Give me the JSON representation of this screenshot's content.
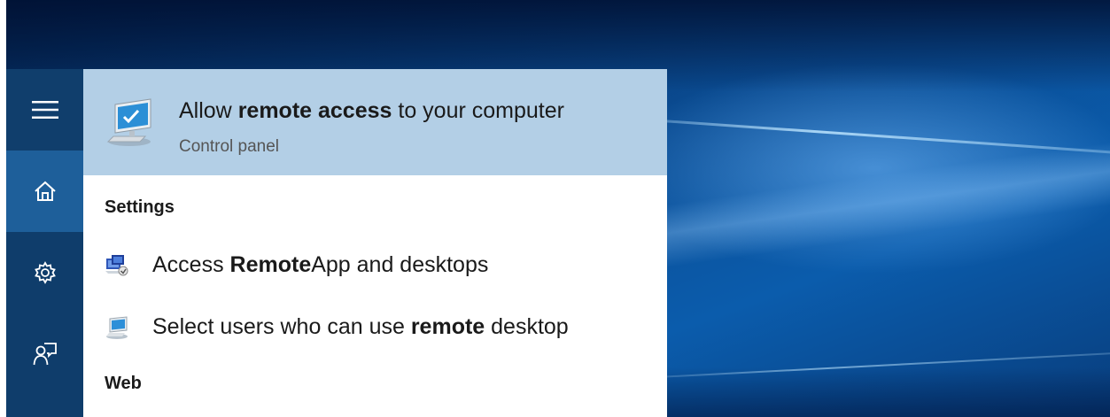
{
  "rail": {
    "menu_icon": "hamburger-icon",
    "home_icon": "home-icon",
    "settings_icon": "gear-icon",
    "feedback_icon": "feedback-icon"
  },
  "top_result": {
    "title_pre": "Allow ",
    "title_bold": "remote access",
    "title_post": " to your computer",
    "subtitle": "Control panel",
    "icon": "monitor-icon"
  },
  "sections": {
    "settings": "Settings",
    "web": "Web"
  },
  "items": [
    {
      "pre": "Access ",
      "bold": "Remote",
      "post": "App and desktops",
      "icon": "remoteapp-icon"
    },
    {
      "pre": "Select users who can use ",
      "bold": "remote",
      "post": " desktop",
      "icon": "remote-desktop-icon"
    }
  ],
  "colors": {
    "rail": "#0f3d6b",
    "rail_selected": "#1e5f9a",
    "top_result_bg": "#b3cfe6"
  }
}
